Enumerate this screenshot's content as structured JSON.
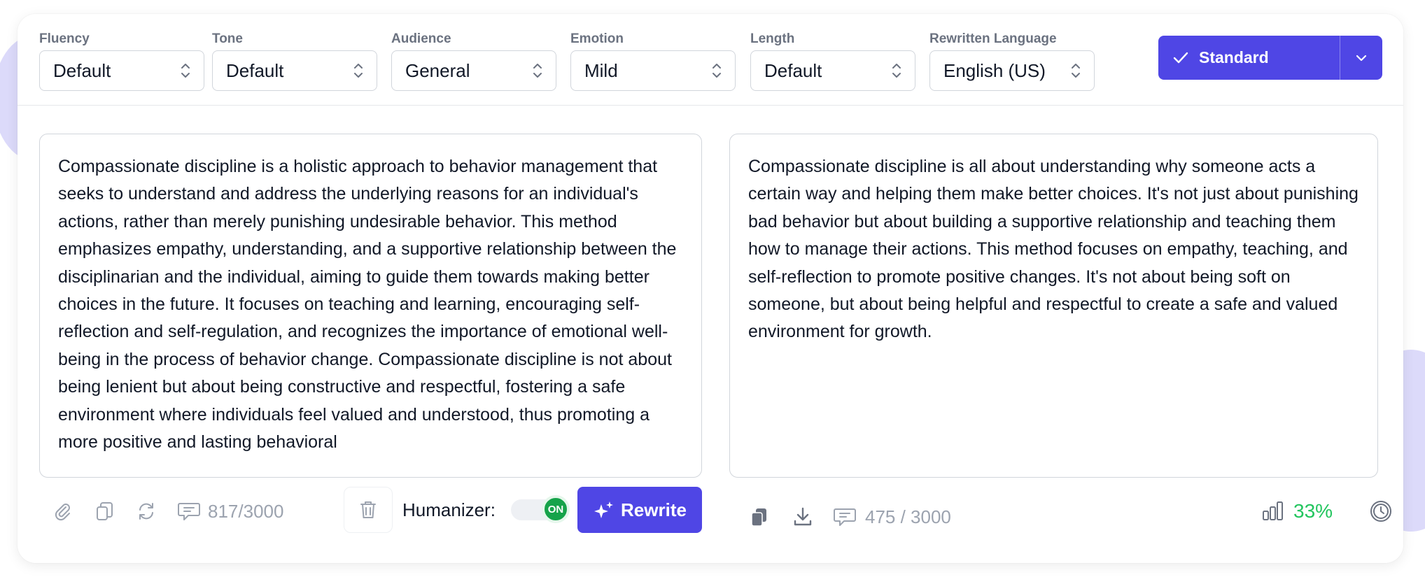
{
  "toolbar": {
    "fluency": {
      "label": "Fluency",
      "value": "Default"
    },
    "tone": {
      "label": "Tone",
      "value": "Default"
    },
    "audience": {
      "label": "Audience",
      "value": "General"
    },
    "emotion": {
      "label": "Emotion",
      "value": "Mild"
    },
    "length": {
      "label": "Length",
      "value": "Default"
    },
    "language": {
      "label": "Rewritten Language",
      "value": "English (US)"
    },
    "mode_button": "Standard"
  },
  "input": {
    "text": "Compassionate discipline is a holistic approach to behavior management that seeks to understand and address the underlying reasons for an individual's actions, rather than merely punishing undesirable behavior. This method emphasizes empathy, understanding, and a supportive relationship between the disciplinarian and the individual, aiming to guide them towards making better choices in the future. It focuses on teaching and learning, encouraging self-reflection and self-regulation, and recognizes the importance of emotional well-being in the process of behavior change. Compassionate discipline is not about being lenient but about being constructive and respectful, fostering a safe environment where individuals feel valued and understood, thus promoting a more positive and lasting behavioral",
    "count": "817/3000",
    "humanizer_label": "Humanizer:",
    "toggle_text": "ON",
    "rewrite_button": "Rewrite"
  },
  "output": {
    "text": "Compassionate discipline is all about understanding why someone acts a certain way and helping them make better choices. It's not just about punishing bad behavior but about building a supportive relationship and teaching them how to manage their actions. This method focuses on empathy, teaching, and self-reflection to promote positive changes. It's not about being soft on someone, but about being helpful and respectful to create a safe and valued environment for growth.",
    "count": "475 / 3000",
    "score": "33%"
  },
  "colors": {
    "accent": "#4f46e5",
    "success": "#22c55e",
    "muted": "#9ca3af"
  }
}
